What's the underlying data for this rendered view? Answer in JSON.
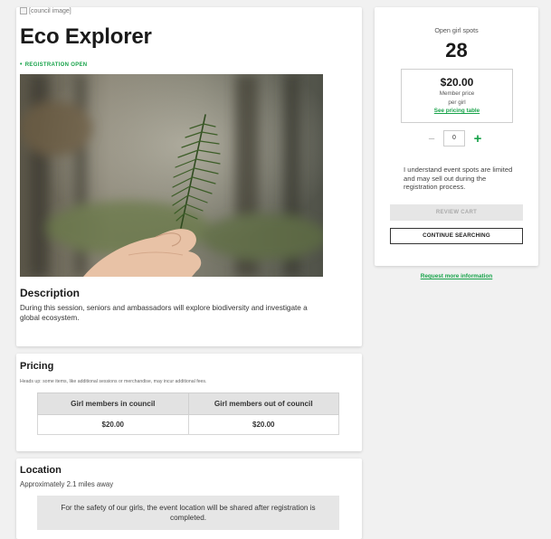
{
  "event": {
    "image_alt": "[council image]",
    "title": "Eco Explorer",
    "status": "REGISTRATION OPEN",
    "description_heading": "Description",
    "description_text": "During this session, seniors and ambassadors will explore biodiversity and investigate a global ecosystem."
  },
  "pricing": {
    "heading": "Pricing",
    "note": "Heads up: some items, like additional sessions or merchandise, may incur additional fees.",
    "columns": [
      "Girl members in council",
      "Girl members out of council"
    ],
    "values": [
      "$20.00",
      "$20.00"
    ]
  },
  "location": {
    "heading": "Location",
    "distance": "Approximately 2.1 miles away",
    "notice": "For the safety of our girls, the event location will be shared after registration is completed."
  },
  "sidebar": {
    "spots_label": "Open girl spots",
    "spots_count": "28",
    "price": "$20.00",
    "price_sub_1": "Member price",
    "price_sub_2": "per girl",
    "pricing_link": "See pricing table",
    "quantity": "0",
    "minus": "−",
    "plus": "+",
    "notice": "I understand event spots are limited and may sell out during the registration process.",
    "review_cart": "REVIEW CART",
    "continue_searching": "CONTINUE SEARCHING",
    "request_info": "Request more information"
  },
  "colors": {
    "accent_green": "#18a34a",
    "page_bg": "#f1f1f1"
  }
}
